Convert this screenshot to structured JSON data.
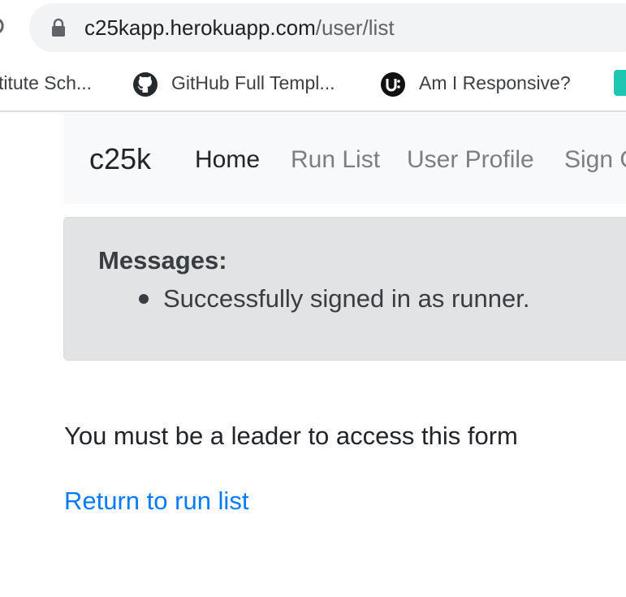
{
  "browser": {
    "url_host": "c25kapp.herokuapp.com",
    "url_path": "/user/list",
    "bookmarks": [
      {
        "label": "titute Sch...",
        "icon": "none"
      },
      {
        "label": "GitHub Full Templ...",
        "icon": "github-icon"
      },
      {
        "label": "Am I Responsive?",
        "icon": "amiresponsive-icon"
      }
    ]
  },
  "navbar": {
    "brand": "c25k",
    "links": [
      {
        "label": "Home",
        "active": true
      },
      {
        "label": "Run List",
        "active": false
      },
      {
        "label": "User Profile",
        "active": false
      },
      {
        "label": "Sign O",
        "active": false
      }
    ]
  },
  "messages": {
    "title": "Messages:",
    "items": [
      "Successfully signed in as runner."
    ]
  },
  "content": {
    "notice": "You must be a leader to access this form",
    "return_link": "Return to run list"
  },
  "colors": {
    "link": "#007bff",
    "navbar_bg": "#f8f9fa",
    "alert_bg": "#e2e3e5"
  }
}
